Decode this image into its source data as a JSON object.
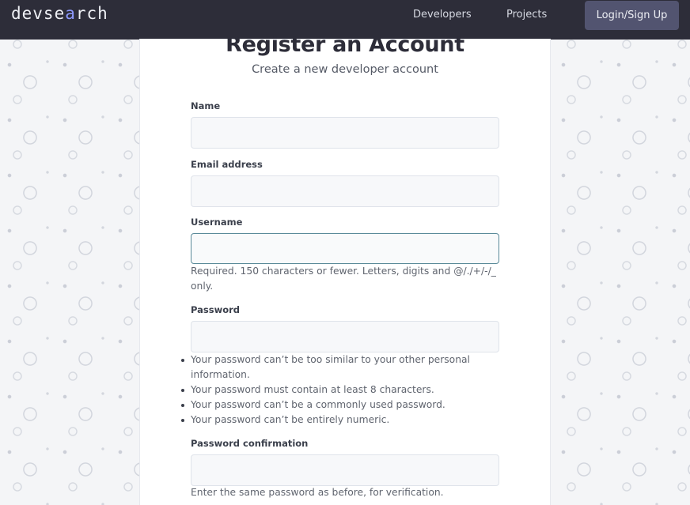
{
  "navbar": {
    "logo_prefix": "devse",
    "logo_mid": "a",
    "logo_suffix": "rch",
    "links": [
      "Developers",
      "Projects"
    ],
    "login_label": "Login/Sign Up"
  },
  "form": {
    "title": "Register an Account",
    "subtitle": "Create a new developer account",
    "name_label": "Name",
    "email_label": "Email address",
    "username_label": "Username",
    "username_help": "Required. 150 characters or fewer. Letters, digits and @/./+/-/_ only.",
    "password_label": "Password",
    "password_rules": [
      "Your password can’t be too similar to your other personal information.",
      "Your password must contain at least 8 characters.",
      "Your password can’t be a commonly used password.",
      "Your password can’t be entirely numeric."
    ],
    "confirm_label": "Password confirmation",
    "confirm_help": "Enter the same password as before, for verification.",
    "values": {
      "name": "",
      "email": "",
      "username": "",
      "password": "",
      "confirm": ""
    }
  },
  "icons": {
    "logo_mark": "magnifier-icon"
  },
  "colors": {
    "navbar": "#2d2d39",
    "login_button": "#525470",
    "focus_border": "#5a8a99"
  }
}
